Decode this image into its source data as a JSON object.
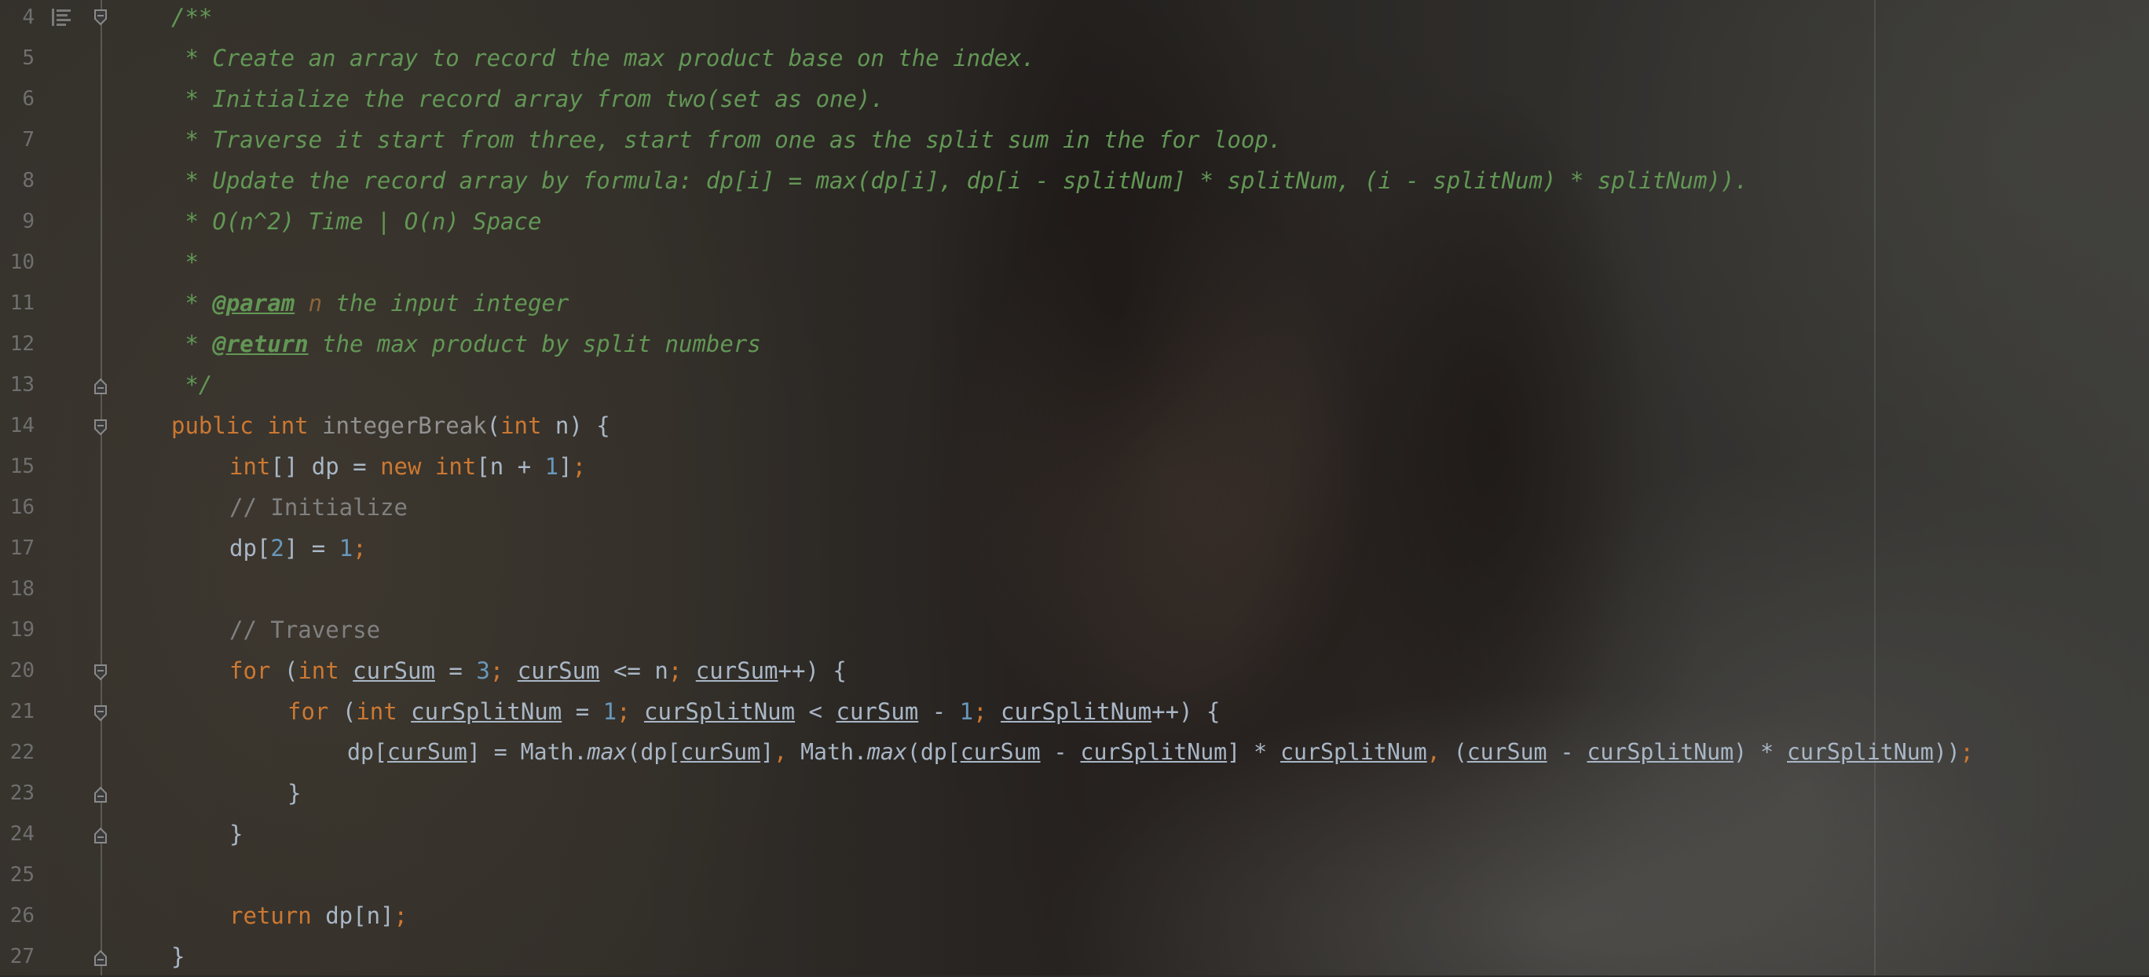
{
  "line_numbers": [
    "4",
    "5",
    "6",
    "7",
    "8",
    "9",
    "10",
    "11",
    "12",
    "13",
    "14",
    "15",
    "16",
    "17",
    "18",
    "19",
    "20",
    "21",
    "22",
    "23",
    "24",
    "25",
    "26",
    "27"
  ],
  "code": {
    "l4": {
      "doc": "/**"
    },
    "l5": {
      "doc": " * Create an array to record the max product base on the index."
    },
    "l6": {
      "doc": " * Initialize the record array from two(set as one)."
    },
    "l7": {
      "doc": " * Traverse it start from three, start from one as the split sum in the for loop."
    },
    "l8": {
      "doc": " * Update the record array by formula: dp[i] = max(dp[i], dp[i - splitNum] * splitNum, (i - splitNum) * splitNum))."
    },
    "l9": {
      "doc": " * O(n^2) Time | O(n) Space"
    },
    "l10": {
      "doc": " *"
    },
    "l11": {
      "prefix": " * ",
      "tag": "@param",
      "param": "n",
      "text": " the input integer"
    },
    "l12": {
      "prefix": " * ",
      "tag": "@return",
      "text": " the max product by split numbers"
    },
    "l13": {
      "doc": " */"
    },
    "l14": {
      "kw1": "public",
      "kw2": "int",
      "fn": "integerBreak",
      "open": "(",
      "kw3": "int",
      "rest": " n) {"
    },
    "l15": {
      "kw1": "int",
      "t1": "[] dp = ",
      "kw2": "new",
      "kw3": "int",
      "t2": "[n + ",
      "num": "1",
      "t3": "]",
      "semi": ";"
    },
    "l16": {
      "comment": "// Initialize"
    },
    "l17": {
      "t1": "dp[",
      "num1": "2",
      "t2": "] = ",
      "num2": "1",
      "semi": ";"
    },
    "l19": {
      "comment": "// Traverse"
    },
    "l20": {
      "kw1": "for",
      "t1": " (",
      "kw2": "int",
      "v1": "curSum",
      "t2": " = ",
      "num1": "3",
      "semi1": ";",
      "v2": "curSum",
      "t3": " <= n",
      "semi2": ";",
      "v3": "curSum",
      "t4": "++) {"
    },
    "l21": {
      "kw1": "for",
      "t1": " (",
      "kw2": "int",
      "v1": "curSplitNum",
      "t2": " = ",
      "num1": "1",
      "semi1": ";",
      "v2": "curSplitNum",
      "t3": " < ",
      "v3": "curSum",
      "t4": " - ",
      "num2": "1",
      "semi2": ";",
      "v4": "curSplitNum",
      "t5": "++) {"
    },
    "l22": {
      "t1": "dp[",
      "v1": "curSum",
      "t2": "] = Math.",
      "m1": "max",
      "t3": "(dp[",
      "v2": "curSum",
      "t4": "]",
      "comma1": ",",
      "t5": " Math.",
      "m2": "max",
      "t6": "(dp[",
      "v3": "curSum",
      "t7": " - ",
      "v4": "curSplitNum",
      "t8": "] * ",
      "v5": "curSplitNum",
      "comma2": ",",
      "t9": " (",
      "v6": "curSum",
      "t10": " - ",
      "v7": "curSplitNum",
      "t11": ") * ",
      "v8": "curSplitNum",
      "t12": "))",
      "semi": ";"
    },
    "l23": {
      "t1": "}"
    },
    "l24": {
      "t1": "}"
    },
    "l26": {
      "kw1": "return",
      "t1": " dp[n]",
      "semi": ";"
    },
    "l27": {
      "t1": "}"
    }
  },
  "colors": {
    "keyword": "#cc7832",
    "number": "#6897bb",
    "comment": "#808080",
    "doc_comment": "#629755",
    "identifier": "#a9b7c6",
    "line_number": "#6f6f6f"
  },
  "icons": [
    "doc-comment-icon",
    "fold-icon"
  ]
}
